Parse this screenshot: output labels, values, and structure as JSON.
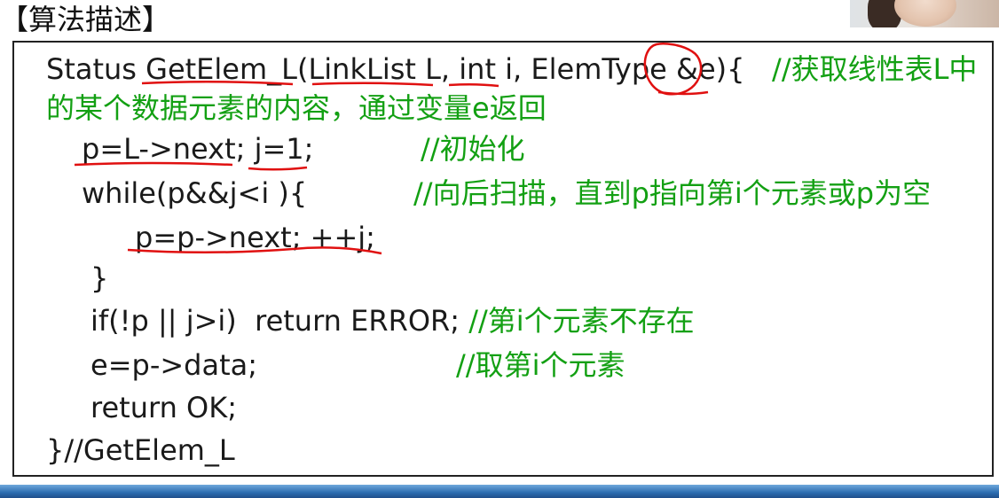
{
  "slide": {
    "title": "【算法描述】"
  },
  "code": [
    {
      "code": "Status GetElem_L(LinkList L, int i, ElemType &e){   ",
      "comment": "//获取线性表L中"
    },
    {
      "code": "",
      "comment": "的某个数据元素的内容，通过变量e返回"
    },
    {
      "code": "p=L->next; j=1;",
      "comment": "//初始化"
    },
    {
      "code": "while(p&&j<i ){",
      "comment": "//向后扫描，直到p指向第i个元素或p为空"
    },
    {
      "code": "p=p->next; ++j;",
      "comment": ""
    },
    {
      "code": "}",
      "comment": ""
    },
    {
      "code": "if(!p || j>i)  return ERROR; ",
      "comment": "//第i个元素不存在"
    },
    {
      "code": "e=p->data;",
      "comment": "//取第i个元素"
    },
    {
      "code": "return OK;",
      "comment": ""
    },
    {
      "code": "}//GetElem_L",
      "comment": ""
    }
  ],
  "colors": {
    "comment": "#13a013",
    "annotation": "#e01010",
    "text": "#1a1a1a",
    "footer": "#2b6cb0"
  }
}
